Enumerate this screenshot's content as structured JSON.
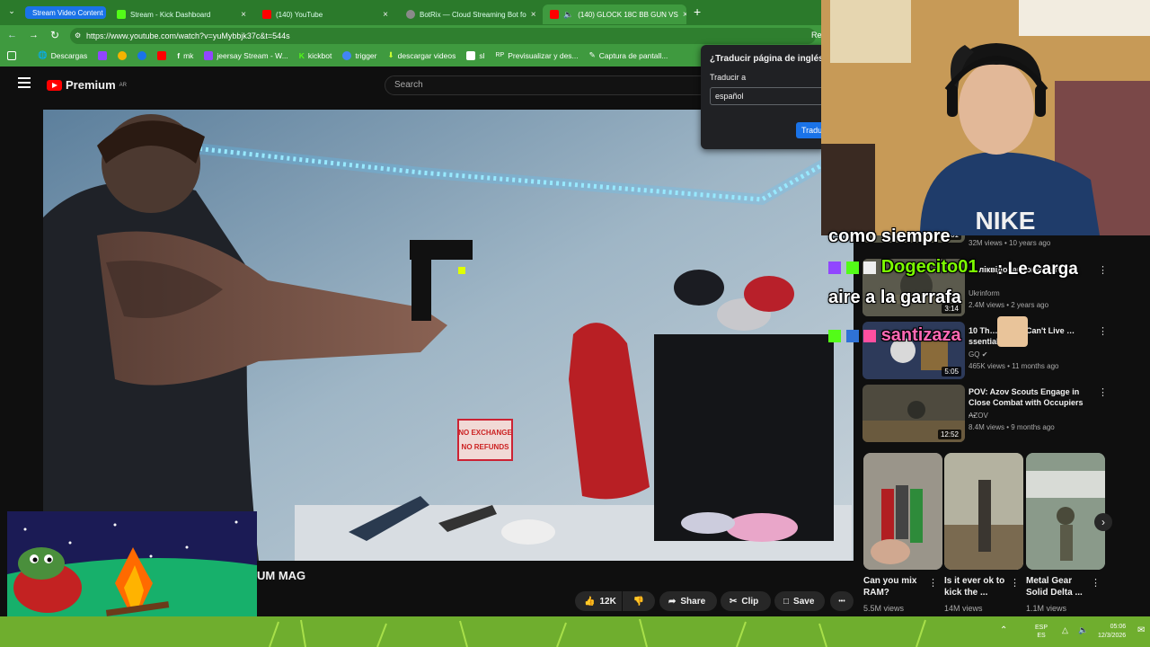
{
  "browser": {
    "tabs": [
      {
        "label": "Stream Video Content",
        "active": false
      },
      {
        "label": "Stream - Kick Dashboard",
        "active": false
      },
      {
        "label": "(140) YouTube",
        "active": false
      },
      {
        "label": "BotRix — Cloud Streaming Bot fo",
        "active": false
      },
      {
        "label": "(140) GLOCK 18C BB GUN VS",
        "active": true
      }
    ],
    "new_tab": "+",
    "url": "https://www.youtube.com/watch?v=yuMybbjk37c&t=544s",
    "reload_hint": "Re",
    "bookmarks": [
      "Descargas",
      "mk",
      "jeersay Stream - W...",
      "kickbot",
      "trigger",
      "descargar videos",
      "sl",
      "Previsualizar y des...",
      "Captura de pantall..."
    ]
  },
  "youtube": {
    "logo_text": "Premium",
    "logo_badge": "AR",
    "search_placeholder": "Search",
    "video_title_fragment": "UM MAG",
    "actions": {
      "likes": "12K",
      "share": "Share",
      "clip": "Clip",
      "save": "Save",
      "more": "•••"
    },
    "video_overlay": {
      "sign_line1": "NO EXCHANGE",
      "sign_line2": "NO REFUNDS"
    }
  },
  "recommendations": [
    {
      "title": "",
      "meta": "32M views • 10 years ago",
      "duration": "21:01"
    },
    {
      "title": "… ліквідовані окупанти",
      "channel": "Ukrinform",
      "meta": "2.4M views • 2 years ago",
      "duration": "3:14"
    },
    {
      "title": "10 Th… spend Can't Live …ssentials",
      "channel": "GQ",
      "meta": "465K views • 11 months ago",
      "duration": "5:05"
    },
    {
      "title": "POV: Azov Scouts Engage in Close Combat with Occupiers ...",
      "channel": "AZOV",
      "meta": "8.4M views • 9 months ago",
      "duration": "12:52"
    }
  ],
  "shorts": [
    {
      "title": "Can you mix RAM?",
      "views": "5.5M views"
    },
    {
      "title": "Is it ever ok to kick the ...",
      "views": "14M views"
    },
    {
      "title": "Metal Gear Solid Delta ...",
      "views": "1.1M views"
    }
  ],
  "translate_popup": {
    "title": "¿Traducir página de inglés",
    "label": "Traducir a",
    "language": "español",
    "button": "Tradu"
  },
  "chat": [
    {
      "user": "",
      "message": "como siempre"
    },
    {
      "user": "Dogecito01",
      "message": ": Le carga aire a la garrafa"
    },
    {
      "user": "santizaza",
      "message": ""
    }
  ],
  "taskbar": {
    "lang_top": "ESP",
    "lang_bottom": "ES",
    "time": "05:06",
    "date": "12/3/2026"
  },
  "colors": {
    "chrome_green": "#3f9a3f",
    "youtube_red": "#ff0000",
    "kick_green": "#53fc18",
    "chat_user_green": "#7cfc00",
    "chat_user_pink": "#ff69b4"
  }
}
